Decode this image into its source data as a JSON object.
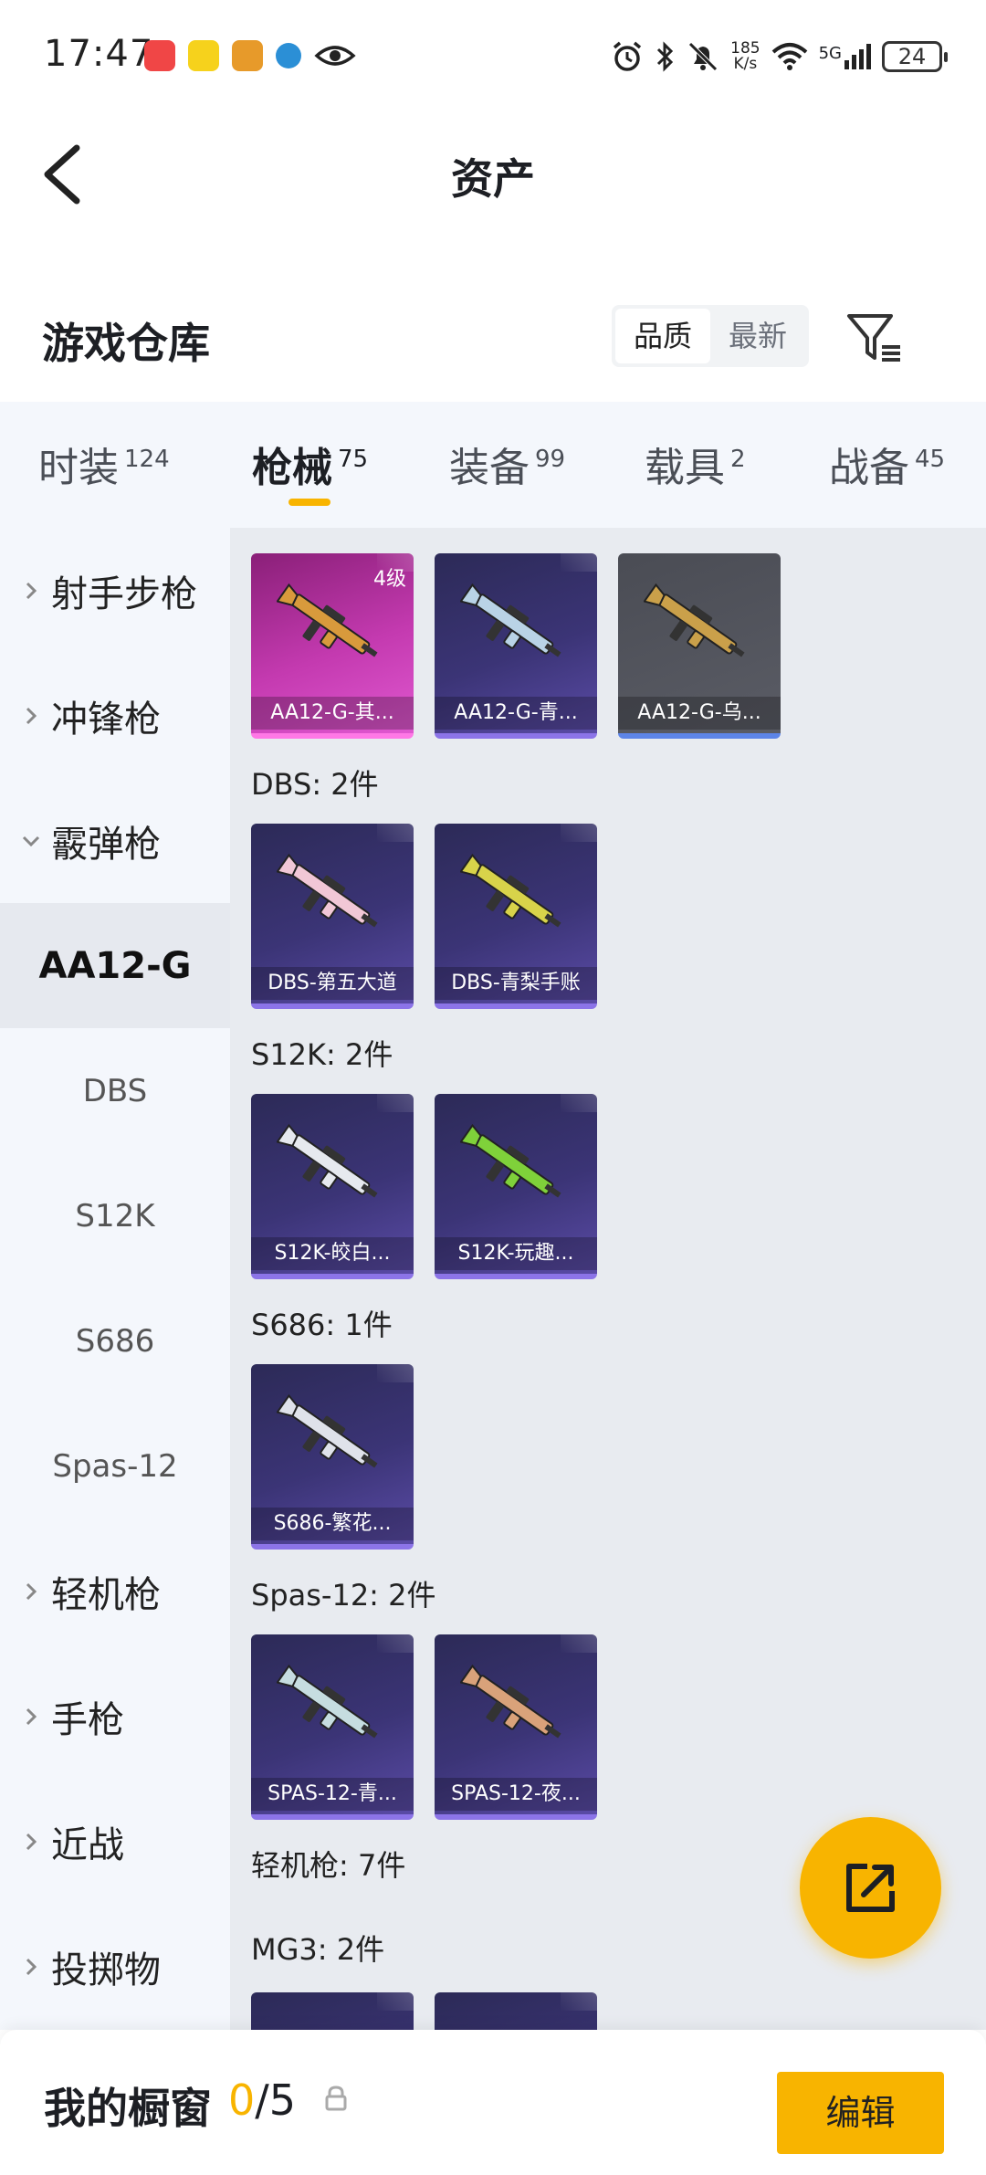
{
  "status_bar": {
    "time": "17:47",
    "network_speed": "185",
    "network_unit": "K/s",
    "network_type": "5G",
    "battery": "24"
  },
  "header": {
    "title": "资产"
  },
  "section": {
    "title": "游戏仓库",
    "sort_options": [
      "品质",
      "最新"
    ],
    "sort_active": "品质"
  },
  "tabs": [
    {
      "label": "时装",
      "count": "124"
    },
    {
      "label": "枪械",
      "count": "75"
    },
    {
      "label": "装备",
      "count": "99"
    },
    {
      "label": "载具",
      "count": "2"
    },
    {
      "label": "战备",
      "count": "45"
    }
  ],
  "active_tab": "枪械",
  "sidebar": [
    {
      "label": "射手步枪",
      "type": "collapsed"
    },
    {
      "label": "冲锋枪",
      "type": "collapsed"
    },
    {
      "label": "霰弹枪",
      "type": "expanded"
    },
    {
      "label": "AA12-G",
      "type": "selected"
    },
    {
      "label": "DBS",
      "type": "sub"
    },
    {
      "label": "S12K",
      "type": "sub"
    },
    {
      "label": "S686",
      "type": "sub"
    },
    {
      "label": "Spas-12",
      "type": "sub"
    },
    {
      "label": "轻机枪",
      "type": "collapsed"
    },
    {
      "label": "手枪",
      "type": "collapsed"
    },
    {
      "label": "近战",
      "type": "collapsed"
    },
    {
      "label": "投掷物",
      "type": "collapsed"
    }
  ],
  "content": {
    "aa12_items": [
      {
        "name": "AA12-G-其...",
        "level": "4级",
        "rarity": "pink",
        "gun_color": "#d89a3c"
      },
      {
        "name": "AA12-G-青...",
        "rarity": "purple",
        "gun_color": "#b9d3e6"
      },
      {
        "name": "AA12-G-乌...",
        "rarity": "gray",
        "gun_color": "#caa04a"
      }
    ],
    "groups": [
      {
        "title": "DBS: 2件",
        "items": [
          {
            "name": "DBS-第五大道",
            "rarity": "purple",
            "gun_color": "#f1c7d6"
          },
          {
            "name": "DBS-青梨手账",
            "rarity": "purple",
            "gun_color": "#d8d34a"
          }
        ]
      },
      {
        "title": "S12K: 2件",
        "items": [
          {
            "name": "S12K-皎白...",
            "rarity": "purple",
            "gun_color": "#e6e9ee"
          },
          {
            "name": "S12K-玩趣...",
            "rarity": "purple",
            "gun_color": "#7fd13a"
          }
        ]
      },
      {
        "title": "S686: 1件",
        "items": [
          {
            "name": "S686-繁花...",
            "rarity": "purple",
            "gun_color": "#dfe2ea"
          }
        ]
      },
      {
        "title": "Spas-12: 2件",
        "items": [
          {
            "name": "SPAS-12-青...",
            "rarity": "purple",
            "gun_color": "#c6dde0"
          },
          {
            "name": "SPAS-12-夜...",
            "rarity": "purple",
            "gun_color": "#d9a27a"
          }
        ]
      }
    ],
    "lmg_title": "轻机枪: 7件",
    "mg3_title": "MG3: 2件"
  },
  "bottom_bar": {
    "title": "我的橱窗",
    "current": "0",
    "total": "/5",
    "edit_label": "编辑"
  },
  "colors": {
    "accent": "#f8b400"
  }
}
